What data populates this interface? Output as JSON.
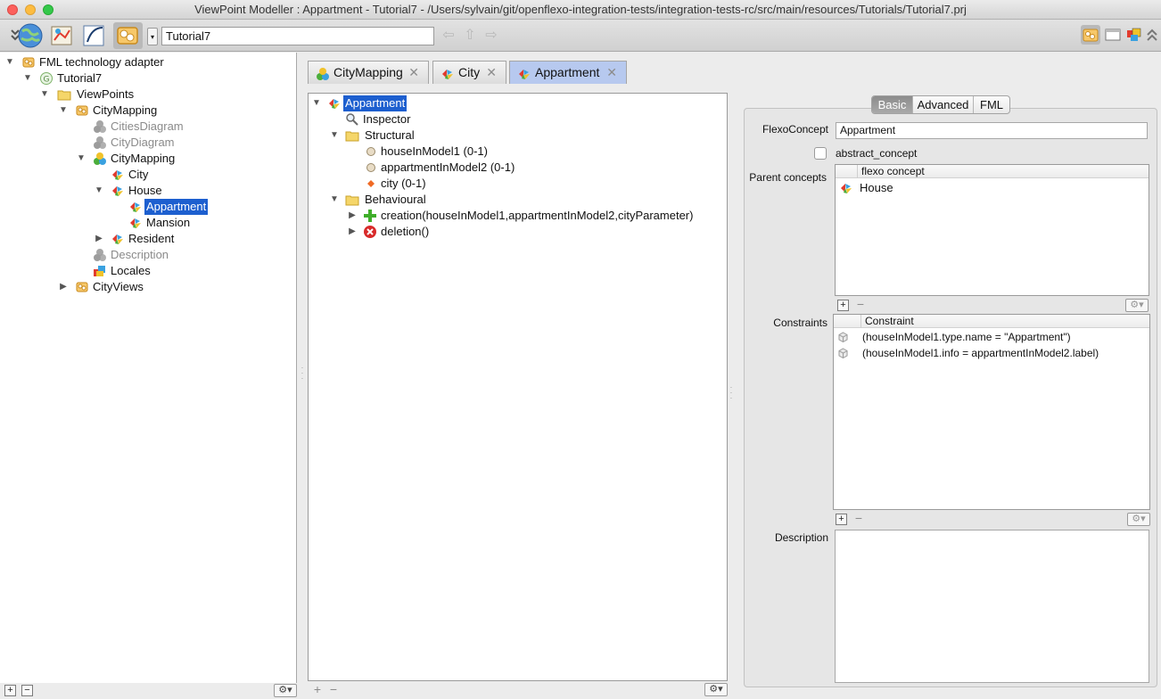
{
  "window": {
    "title": "ViewPoint Modeller : Appartment - Tutorial7 - /Users/sylvain/git/openflexo-integration-tests/integration-tests-rc/src/main/resources/Tutorials/Tutorial7.prj"
  },
  "toolbar": {
    "project_value": "Tutorial7",
    "icons": [
      "collapse-icon",
      "globe-icon",
      "diagram-editor-icon",
      "pen-tool-icon",
      "viewpoint-modeller-icon"
    ],
    "right_icons": [
      "viewpoint-icon",
      "window-icon",
      "module-icon",
      "collapse-up-icon"
    ]
  },
  "left_tree": {
    "items": [
      {
        "label": "FML technology adapter"
      },
      {
        "label": "Tutorial7"
      },
      {
        "label": "ViewPoints"
      },
      {
        "label": "CityMapping"
      },
      {
        "label": "CitiesDiagram"
      },
      {
        "label": "CityDiagram"
      },
      {
        "label": "CityMapping"
      },
      {
        "label": "City"
      },
      {
        "label": "House"
      },
      {
        "label": "Appartment"
      },
      {
        "label": "Mansion"
      },
      {
        "label": "Resident"
      },
      {
        "label": "Description"
      },
      {
        "label": "Locales"
      },
      {
        "label": "CityViews"
      }
    ]
  },
  "tabs": [
    {
      "label": "CityMapping"
    },
    {
      "label": "City"
    },
    {
      "label": "Appartment"
    }
  ],
  "center_tree": {
    "items": [
      {
        "label": "Appartment"
      },
      {
        "label": "Inspector"
      },
      {
        "label": "Structural"
      },
      {
        "label": "houseInModel1 (0-1)"
      },
      {
        "label": "appartmentInModel2 (0-1)"
      },
      {
        "label": "city (0-1)"
      },
      {
        "label": "Behavioural"
      },
      {
        "label": "creation(houseInModel1,appartmentInModel2,cityParameter)"
      },
      {
        "label": "deletion()"
      }
    ]
  },
  "inspector": {
    "tabs": [
      "Basic",
      "Advanced",
      "FML"
    ],
    "active_tab": "Basic",
    "flexo_concept_label": "FlexoConcept",
    "flexo_concept_value": "Appartment",
    "abstract_label": "abstract_concept",
    "abstract_checked": false,
    "parent_concepts_label": "Parent concepts",
    "parent_concepts_header": "flexo concept",
    "parent_concepts": [
      {
        "label": "House"
      }
    ],
    "constraints_label": "Constraints",
    "constraints_header": "Constraint",
    "constraints": [
      {
        "label": "(houseInModel1.type.name = \"Appartment\")"
      },
      {
        "label": "(houseInModel1.info = appartmentInModel2.label)"
      }
    ],
    "description_label": "Description",
    "description_value": ""
  },
  "buttons": {
    "add": "+",
    "remove": "−",
    "gear": "⚙▾"
  },
  "colors": {
    "selection": "#1d5fcf",
    "active_tab": "#b7c9ef"
  }
}
